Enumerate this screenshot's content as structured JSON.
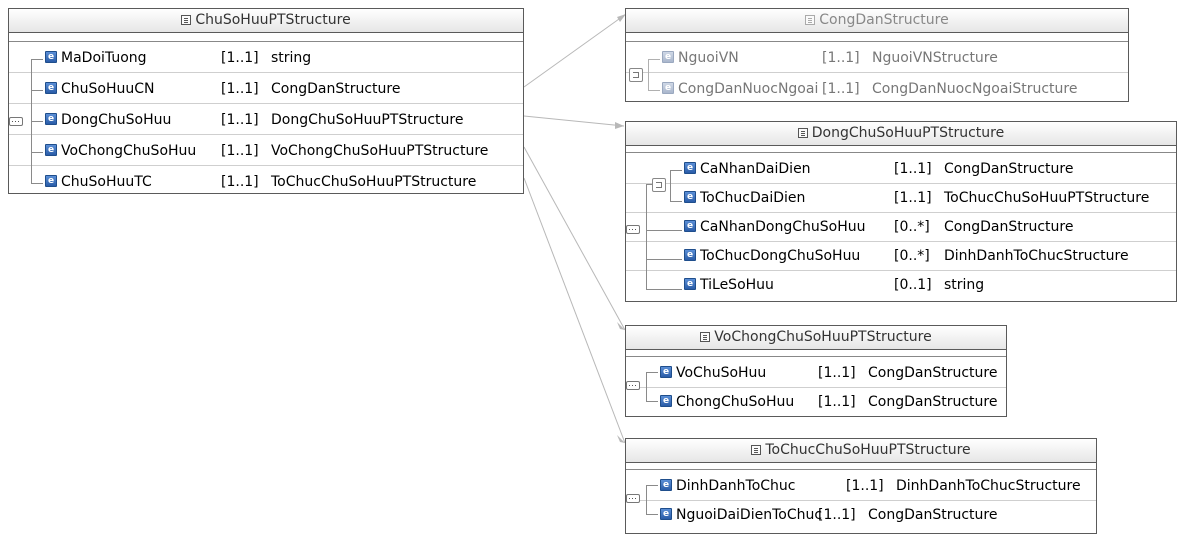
{
  "diagram": {
    "chusohuu": {
      "title": "ChuSoHuuPTStructure",
      "rows": [
        {
          "name": "MaDoiTuong",
          "card": "[1..1]",
          "type": "string"
        },
        {
          "name": "ChuSoHuuCN",
          "card": "[1..1]",
          "type": "CongDanStructure"
        },
        {
          "name": "DongChuSoHuu",
          "card": "[1..1]",
          "type": "DongChuSoHuuPTStructure"
        },
        {
          "name": "VoChongChuSoHuu",
          "card": "[1..1]",
          "type": "VoChongChuSoHuuPTStructure"
        },
        {
          "name": "ChuSoHuuTC",
          "card": "[1..1]",
          "type": "ToChucChuSoHuuPTStructure"
        }
      ]
    },
    "congdan": {
      "title": "CongDanStructure",
      "rows": [
        {
          "name": "NguoiVN",
          "card": "[1..1]",
          "type": "NguoiVNStructure"
        },
        {
          "name": "CongDanNuocNgoai",
          "card": "[1..1]",
          "type": "CongDanNuocNgoaiStructure"
        }
      ]
    },
    "dongchusohuu": {
      "title": "DongChuSoHuuPTStructure",
      "rows": [
        {
          "name": "CaNhanDaiDien",
          "card": "[1..1]",
          "type": "CongDanStructure"
        },
        {
          "name": "ToChucDaiDien",
          "card": "[1..1]",
          "type": "ToChucChuSoHuuPTStructure"
        },
        {
          "name": "CaNhanDongChuSoHuu",
          "card": "[0..*]",
          "type": "CongDanStructure"
        },
        {
          "name": "ToChucDongChuSoHuu",
          "card": "[0..*]",
          "type": "DinhDanhToChucStructure"
        },
        {
          "name": "TiLeSoHuu",
          "card": "[0..1]",
          "type": "string"
        }
      ]
    },
    "vochong": {
      "title": "VoChongChuSoHuuPTStructure",
      "rows": [
        {
          "name": "VoChuSoHuu",
          "card": "[1..1]",
          "type": "CongDanStructure"
        },
        {
          "name": "ChongChuSoHuu",
          "card": "[1..1]",
          "type": "CongDanStructure"
        }
      ]
    },
    "tochuc": {
      "title": "ToChucChuSoHuuPTStructure",
      "rows": [
        {
          "name": "DinhDanhToChuc",
          "card": "[1..1]",
          "type": "DinhDanhToChucStructure"
        },
        {
          "name": "NguoiDaiDienToChuc",
          "card": "[1..1]",
          "type": "CongDanStructure"
        }
      ]
    },
    "element_icon_glyph": "e"
  }
}
